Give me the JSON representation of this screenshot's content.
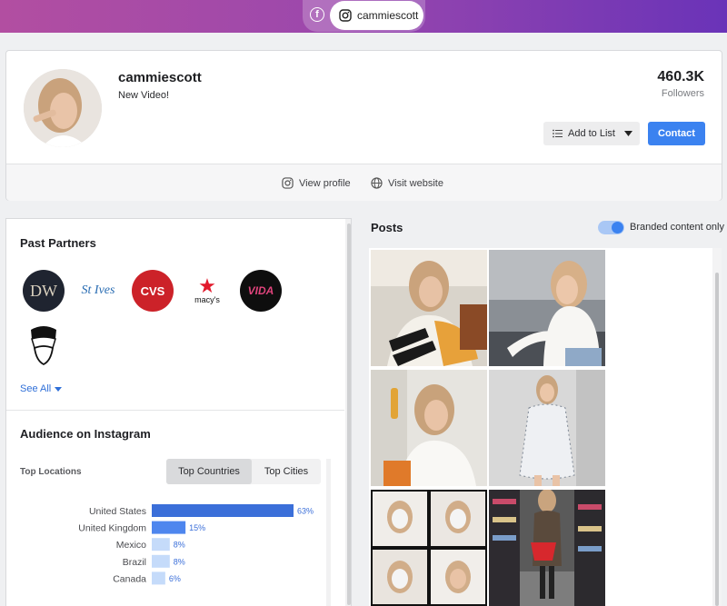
{
  "platform_switch": {
    "facebook_icon": "facebook-icon",
    "instagram_icon": "instagram-icon",
    "active_handle": "cammiescott"
  },
  "profile": {
    "username": "cammiescott",
    "bio": "New Video!",
    "followers_count": "460.3K",
    "followers_label": "Followers",
    "add_to_list_label": "Add to List",
    "contact_label": "Contact",
    "view_profile_label": "View profile",
    "visit_website_label": "Visit website"
  },
  "past_partners": {
    "title": "Past Partners",
    "partners": [
      {
        "logo_text": "DW",
        "bg": "#1f2430",
        "fg": "#d9d0be"
      },
      {
        "logo_text": "St Ives",
        "bg": "#ffffff",
        "fg": "#2a6db3"
      },
      {
        "logo_text": "CVS",
        "bg": "#cc2229",
        "fg": "#ffffff"
      },
      {
        "logo_text": "macy's",
        "bg": "#ffffff",
        "fg": "#111111"
      },
      {
        "logo_text": "VIDA",
        "bg": "#0e0e0e",
        "fg": "#e0447c"
      },
      {
        "logo_text": "",
        "bg": "#ffffff",
        "fg": "#111111"
      }
    ],
    "see_all_label": "See All"
  },
  "audience": {
    "title": "Audience on Instagram",
    "top_locations_label": "Top Locations",
    "tabs": [
      "Top Countries",
      "Top Cities"
    ],
    "active_tab": "Top Countries"
  },
  "chart_data": {
    "type": "bar",
    "orientation": "horizontal",
    "categories": [
      "United States",
      "United Kingdom",
      "Mexico",
      "Brazil",
      "Canada"
    ],
    "values": [
      63,
      15,
      8,
      8,
      6
    ],
    "value_labels": [
      "63%",
      "15%",
      "8%",
      "8%",
      "6%"
    ],
    "colors": [
      "#3b6fd9",
      "#4e86ee",
      "#c5dbfa",
      "#c5dbfa",
      "#c5dbfa"
    ],
    "xlim": [
      0,
      100
    ]
  },
  "posts": {
    "title": "Posts",
    "branded_toggle_label": "Branded content only",
    "branded_toggle_on": true
  }
}
